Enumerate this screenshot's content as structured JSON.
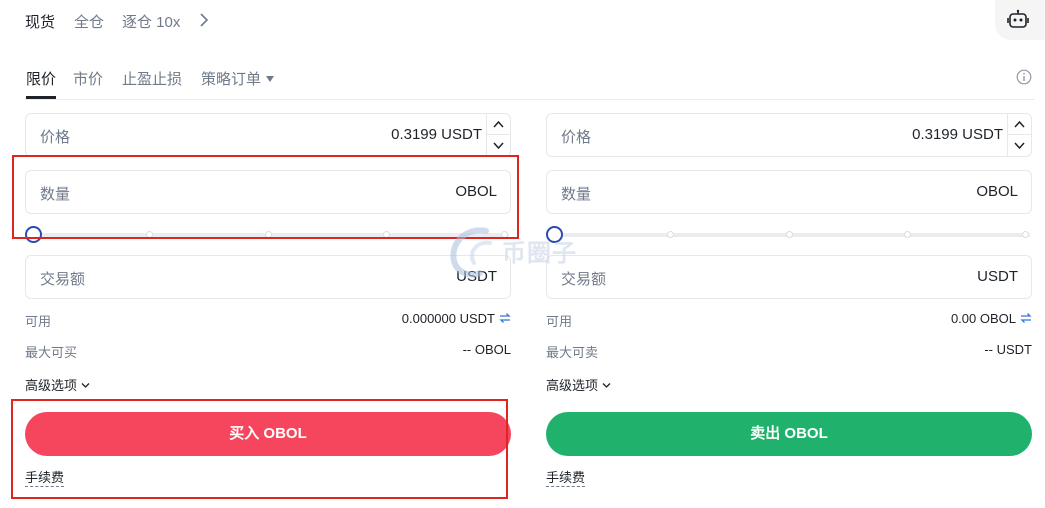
{
  "top_tabs": [
    "现货",
    "全仓",
    "逐仓 10x"
  ],
  "icons": {
    "chevron": "chevron-right-icon",
    "robot": "robot-icon",
    "info": "info-icon",
    "swap": "swap-icon",
    "caret": "caret-down-icon"
  },
  "order_tabs": [
    "限价",
    "市价",
    "止盈止损",
    "策略订单"
  ],
  "buy": {
    "price_label": "价格",
    "price_value": "0.3199 USDT",
    "amount_label": "数量",
    "amount_unit": "OBOL",
    "slider_percent": 0,
    "total_label": "交易额",
    "total_unit": "USDT",
    "available_label": "可用",
    "available_value": "0.000000 USDT",
    "max_label": "最大可买",
    "max_value": "-- OBOL",
    "advanced_label": "高级选项",
    "button_label": "买入 OBOL",
    "fee_label": "手续费"
  },
  "sell": {
    "price_label": "价格",
    "price_value": "0.3199 USDT",
    "amount_label": "数量",
    "amount_unit": "OBOL",
    "slider_percent": 0,
    "total_label": "交易额",
    "total_unit": "USDT",
    "available_label": "可用",
    "available_value": "0.00 OBOL",
    "max_label": "最大可卖",
    "max_value": "-- USDT",
    "advanced_label": "高级选项",
    "button_label": "卖出 OBOL",
    "fee_label": "手续费"
  },
  "colors": {
    "buy": "#f6465d",
    "sell": "#20b26c",
    "highlight": "#e0241f",
    "slider_thumb": "#2a4bb3"
  },
  "watermark_text": "币圈子"
}
